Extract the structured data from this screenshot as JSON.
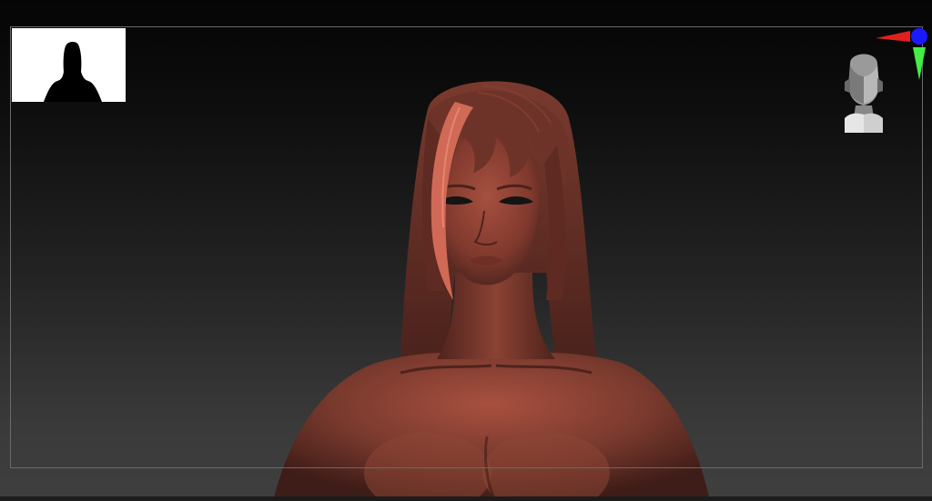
{
  "viewport": {
    "background_top": "#050505",
    "background_bottom": "#3f3f3f",
    "frame_color": "#6a6a6a"
  },
  "model": {
    "material_color": "#6a2f26",
    "highlight_color": "#c9604f",
    "hair_strand_color": "#e07a63"
  },
  "navigator": {
    "background": "#ffffff",
    "silhouette_color": "#000000"
  },
  "gizmo": {
    "x_axis_color": "#e02020",
    "y_axis_color": "#44ee44",
    "z_axis_color": "#1a1aff"
  },
  "icons": {
    "orientation_head": "orientation-head-icon",
    "axis_gizmo": "axis-gizmo-icon"
  }
}
